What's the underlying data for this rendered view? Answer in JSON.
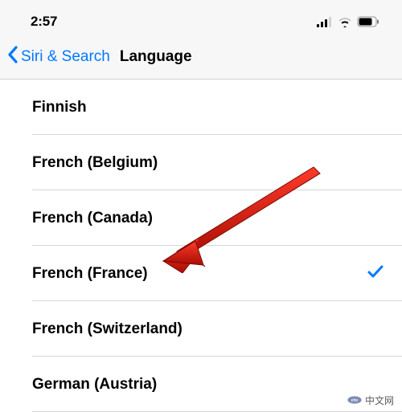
{
  "status": {
    "time": "2:57"
  },
  "nav": {
    "back_label": "Siri & Search",
    "title": "Language"
  },
  "languages": {
    "items": [
      {
        "label": "Finnish",
        "selected": false
      },
      {
        "label": "French (Belgium)",
        "selected": false
      },
      {
        "label": "French (Canada)",
        "selected": false
      },
      {
        "label": "French (France)",
        "selected": true
      },
      {
        "label": "French (Switzerland)",
        "selected": false
      },
      {
        "label": "German (Austria)",
        "selected": false
      }
    ]
  },
  "watermark": {
    "text": "中文网"
  }
}
